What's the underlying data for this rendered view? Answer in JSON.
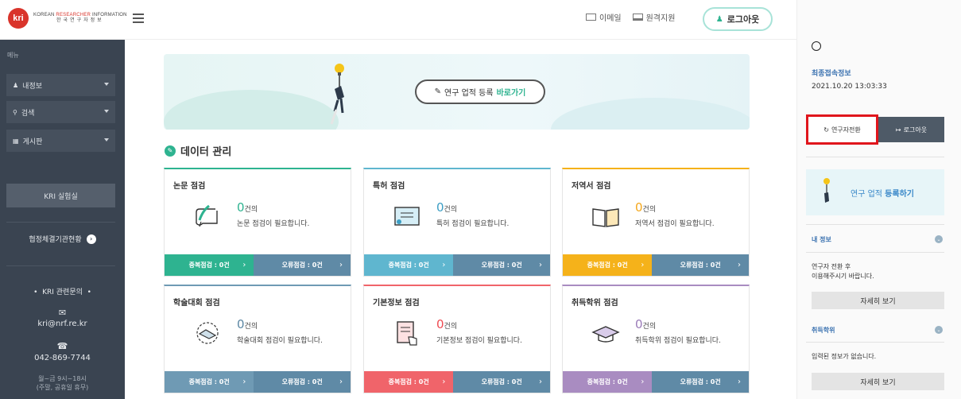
{
  "header": {
    "logo_mark": "kri",
    "logo_en_1": "KOREAN ",
    "logo_en_2": "RESEARCHER",
    "logo_en_3": " INFORMATION",
    "logo_ko": "한국연구자정보",
    "email_label": "이메일",
    "remote_label": "원격지원",
    "logout_label": "로그아웃"
  },
  "sidebar": {
    "menu_title": "메뉴",
    "items": [
      {
        "icon": "person-icon",
        "label": "내정보"
      },
      {
        "icon": "search-icon",
        "label": "검색"
      },
      {
        "icon": "board-icon",
        "label": "게시판"
      }
    ],
    "lab_label": "KRI 실험실",
    "agreement_label": "협정체결기관현황",
    "contact_title": "KRI 관련문의",
    "email": "kri@nrf.re.kr",
    "phone": "042-869-7744",
    "hours_1": "월~금 9시~18시",
    "hours_2": "(주말, 공휴일 휴무)"
  },
  "banner": {
    "button_text": "연구 업적 등록",
    "button_go": "바로가기"
  },
  "section": {
    "title": "데이터 관리"
  },
  "cards": [
    {
      "title": "논문 점검",
      "count": "0",
      "unit": "건의",
      "desc": "논문 점검이 필요합니다.",
      "dup": "중복점검 : 0건",
      "err": "오류점검 : 0건",
      "color": "#2eb390",
      "count_color": "#2eb390",
      "icon": "scroll-quill-icon"
    },
    {
      "title": "특허 점검",
      "count": "0",
      "unit": "건의",
      "desc": "특허 점검이 필요합니다.",
      "dup": "중복점검 : 0건",
      "err": "오류점검 : 0건",
      "color": "#5fb6cf",
      "count_color": "#3c9ec4",
      "icon": "certificate-icon"
    },
    {
      "title": "저역서 점검",
      "count": "0",
      "unit": "건의",
      "desc": "저역서 점검이 필요합니다.",
      "dup": "중복점검 : 0건",
      "err": "오류점검 : 0건",
      "color": "#f5b21a",
      "count_color": "#f5a71a",
      "icon": "open-book-icon"
    },
    {
      "title": "학술대회 점검",
      "count": "0",
      "unit": "건의",
      "desc": "학술대회 점검이 필요합니다.",
      "dup": "중복점검 : 0건",
      "err": "오류점검 : 0건",
      "color": "#6f9ab4",
      "count_color": "#5b87a3",
      "icon": "handshake-laurel-icon"
    },
    {
      "title": "기본정보 점검",
      "count": "0",
      "unit": "건의",
      "desc": "기본정보 점검이 필요합니다.",
      "dup": "중복점검 : 0건",
      "err": "오류점검 : 0건",
      "color": "#f0646a",
      "count_color": "#ee4b52",
      "icon": "document-hand-icon"
    },
    {
      "title": "취득학위 점검",
      "count": "0",
      "unit": "건의",
      "desc": "취득학위 점검이 필요합니다.",
      "dup": "중복점검 : 0건",
      "err": "오류점검 : 0건",
      "color": "#a98cc1",
      "count_color": "#9a7bb8",
      "icon": "graduation-cap-icon"
    }
  ],
  "right_panel": {
    "last_access_label": "최종접속정보",
    "last_access_date": "2021.10.20 13:03:33",
    "switch_label": "연구자전환",
    "logout_label": "로그아웃",
    "banner_text_1": "연구 업적 ",
    "banner_text_2": "등록하기",
    "my_info_label": "내 정보",
    "my_info_text_1": "연구자 전환 후",
    "my_info_text_2": "이용해주시기 바랍니다.",
    "more_label": "자세히 보기",
    "degree_label": "취득학위",
    "degree_text": "입력된 정보가 없습니다.",
    "more_label_2": "자세히 보기"
  }
}
